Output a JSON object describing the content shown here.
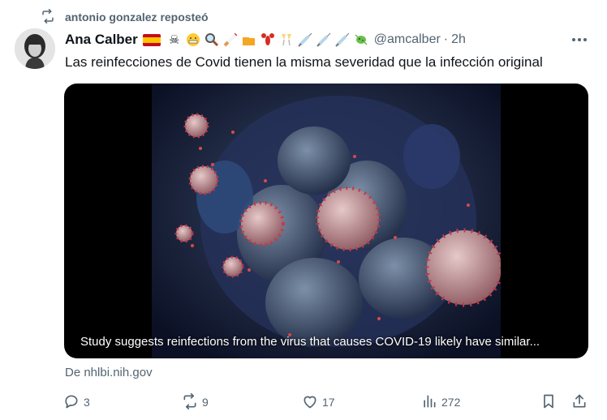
{
  "repost": {
    "text": "antonio gonzalez reposteó",
    "icon": "repost-icon"
  },
  "author": {
    "name": "Ana Calber",
    "emojis": [
      "flag-spain",
      "skull-crossbones",
      "grimacing-face",
      "magnifying-glass",
      "cigarette",
      "beer-mugs",
      "lobster",
      "champagne-toast",
      "syringe",
      "syringe",
      "syringe",
      "microbe"
    ],
    "handle": "@amcalber",
    "separator": "·",
    "time": "2h"
  },
  "post": {
    "text": "Las reinfecciones de Covid tienen la misma severidad que la infección original"
  },
  "media": {
    "caption": "Study suggests reinfections from the virus that causes COVID-19 likely have similar...",
    "source": "De nhlbi.nih.gov"
  },
  "actions": {
    "replies": "3",
    "reposts": "9",
    "likes": "17",
    "views": "272"
  },
  "colors": {
    "text": "#0f1419",
    "muted": "#536471",
    "background": "#ffffff"
  }
}
